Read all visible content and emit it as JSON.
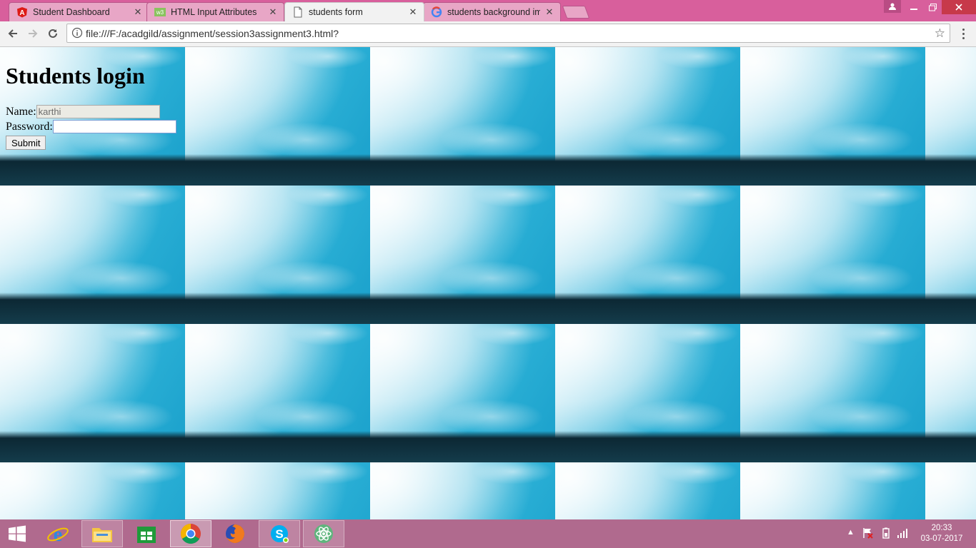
{
  "browser": {
    "tabs": [
      {
        "title": "Student Dashboard",
        "favicon": "angular-icon",
        "active": false
      },
      {
        "title": "HTML Input Attributes",
        "favicon": "w3schools-icon",
        "active": false
      },
      {
        "title": "students form",
        "favicon": "page-icon",
        "active": true
      },
      {
        "title": "students background im",
        "favicon": "google-icon",
        "active": false
      }
    ],
    "url": "file:///F:/acadgild/assignment/session3assignment3.html?"
  },
  "page": {
    "heading": "Students login",
    "form": {
      "name_label": "Name:",
      "name_value": "karthi",
      "password_label": "Password:",
      "password_value": "",
      "submit_label": "Submit"
    }
  },
  "taskbar": {
    "apps": [
      "internet-explorer-icon",
      "file-explorer-icon",
      "store-icon",
      "chrome-icon",
      "firefox-icon",
      "skype-icon",
      "atom-icon"
    ],
    "time": "20:33",
    "date": "03-07-2017"
  },
  "colors": {
    "tabstrip": "#d85f9c",
    "taskbar": "#b06a8e",
    "sky": "#1aa3cc"
  }
}
